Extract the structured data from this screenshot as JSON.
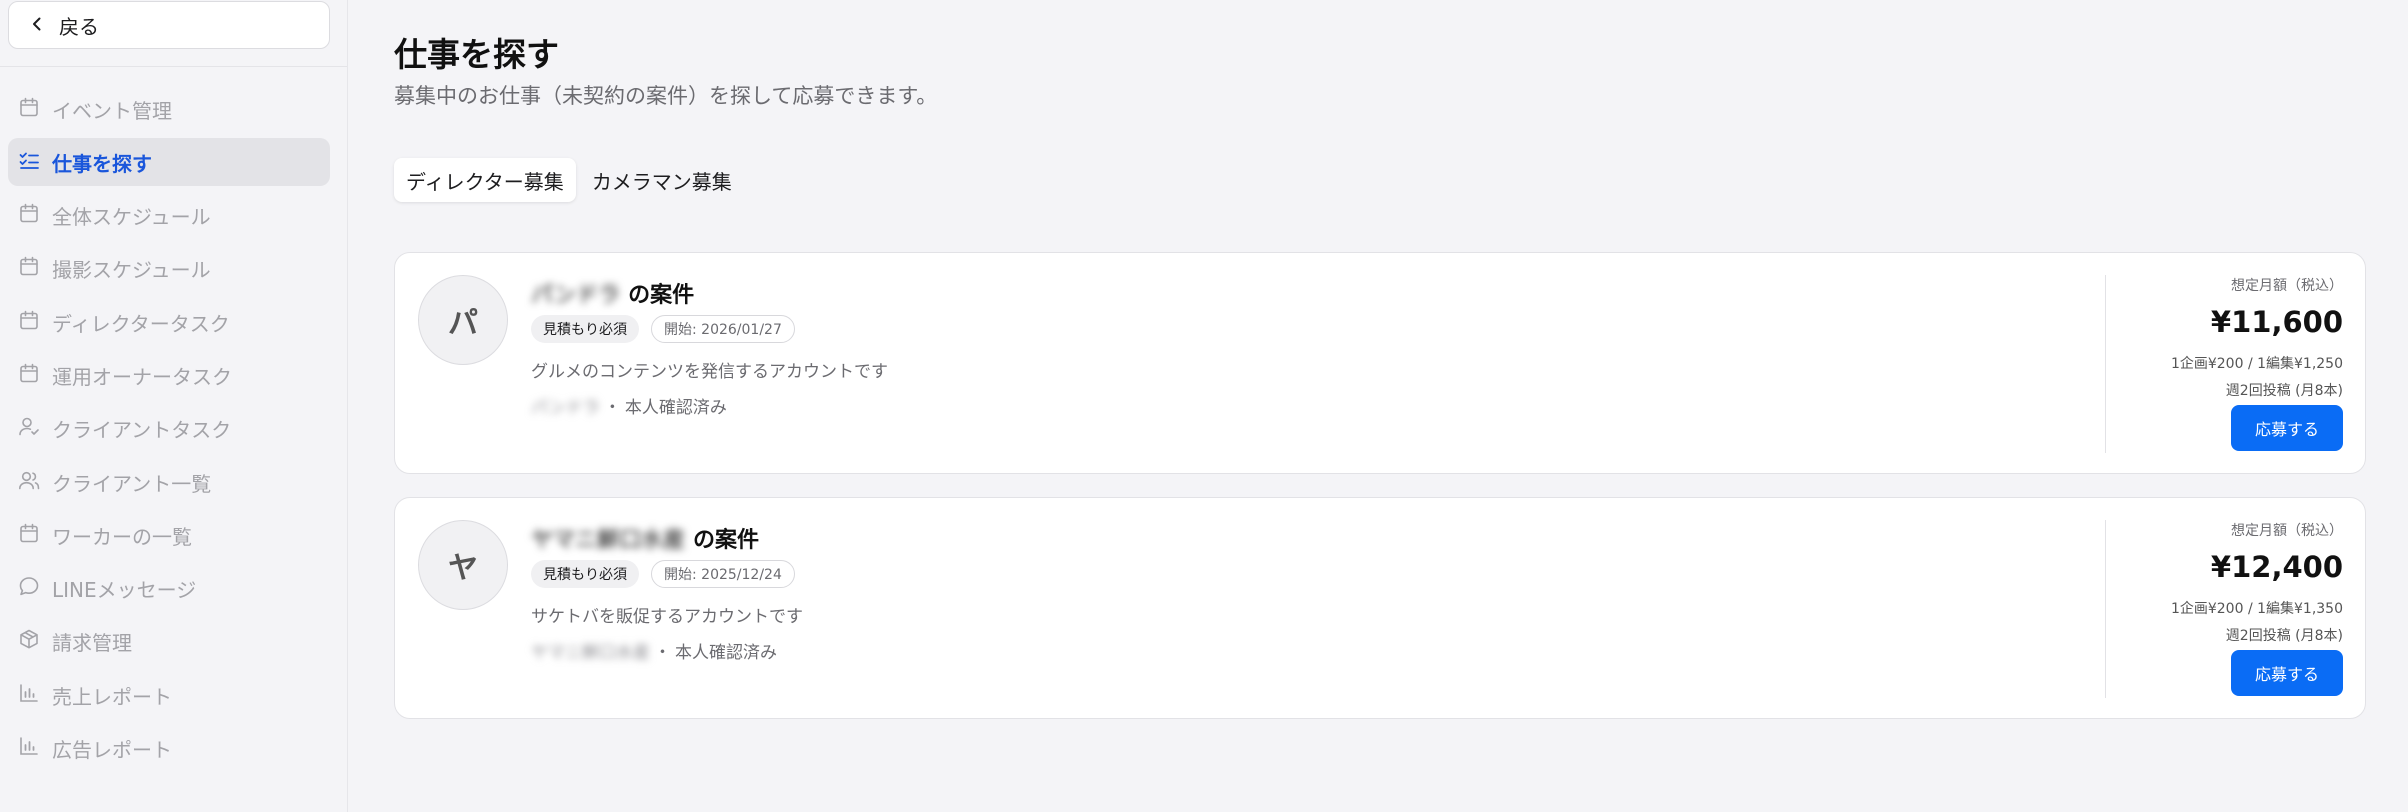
{
  "sidebar": {
    "back_label": "戻る",
    "items": [
      {
        "label": "イベント管理",
        "icon": "calendar-icon",
        "active": false
      },
      {
        "label": "仕事を探す",
        "icon": "checklist-icon",
        "active": true
      },
      {
        "label": "全体スケジュール",
        "icon": "calendar-icon",
        "active": false
      },
      {
        "label": "撮影スケジュール",
        "icon": "calendar-icon",
        "active": false
      },
      {
        "label": "ディレクタータスク",
        "icon": "calendar-icon",
        "active": false
      },
      {
        "label": "運用オーナータスク",
        "icon": "calendar-icon",
        "active": false
      },
      {
        "label": "クライアントタスク",
        "icon": "user-check-icon",
        "active": false
      },
      {
        "label": "クライアント一覧",
        "icon": "users-icon",
        "active": false
      },
      {
        "label": "ワーカーの一覧",
        "icon": "calendar-icon",
        "active": false
      },
      {
        "label": "LINEメッセージ",
        "icon": "chat-bubble-icon",
        "active": false
      },
      {
        "label": "請求管理",
        "icon": "box-icon",
        "active": false
      },
      {
        "label": "売上レポート",
        "icon": "bar-chart-icon",
        "active": false
      },
      {
        "label": "広告レポート",
        "icon": "bar-chart-icon",
        "active": false
      }
    ]
  },
  "main": {
    "title": "仕事を探す",
    "subtitle": "募集中のお仕事（未契約の案件）を探して応募できます。",
    "tabs": [
      {
        "label": "ディレクター募集",
        "active": true
      },
      {
        "label": "カメラマン募集",
        "active": false
      }
    ]
  },
  "jobs": [
    {
      "avatar": "パ",
      "client_name": "パンドラ",
      "title_suffix": "の案件",
      "badge_estimate": "見積もり必須",
      "badge_start": "開始: 2026/01/27",
      "description": "グルメのコンテンツを発信するアカウントです",
      "owner_name": "パンドラ",
      "owner_separator": "・",
      "verified": "本人確認済み",
      "price_label": "想定月額（税込）",
      "price": "¥11,600",
      "price_detail": "1企画¥200 / 1編集¥1,250",
      "frequency": "週2回投稿 (月8本)",
      "apply_label": "応募する"
    },
    {
      "avatar": "ヤ",
      "client_name": "ヤマニ鮮口水産",
      "title_suffix": "の案件",
      "badge_estimate": "見積もり必須",
      "badge_start": "開始: 2025/12/24",
      "description": "サケトバを販促するアカウントです",
      "owner_name": "ヤマニ鮮口水産",
      "owner_separator": "・",
      "verified": "本人確認済み",
      "price_label": "想定月額（税込）",
      "price": "¥12,400",
      "price_detail": "1企画¥200 / 1編集¥1,350",
      "frequency": "週2回投稿 (月8本)",
      "apply_label": "応募する"
    }
  ],
  "colors": {
    "accent": "#0a6cf5",
    "active_nav_text": "#1a56db",
    "background": "#f4f4f7"
  }
}
